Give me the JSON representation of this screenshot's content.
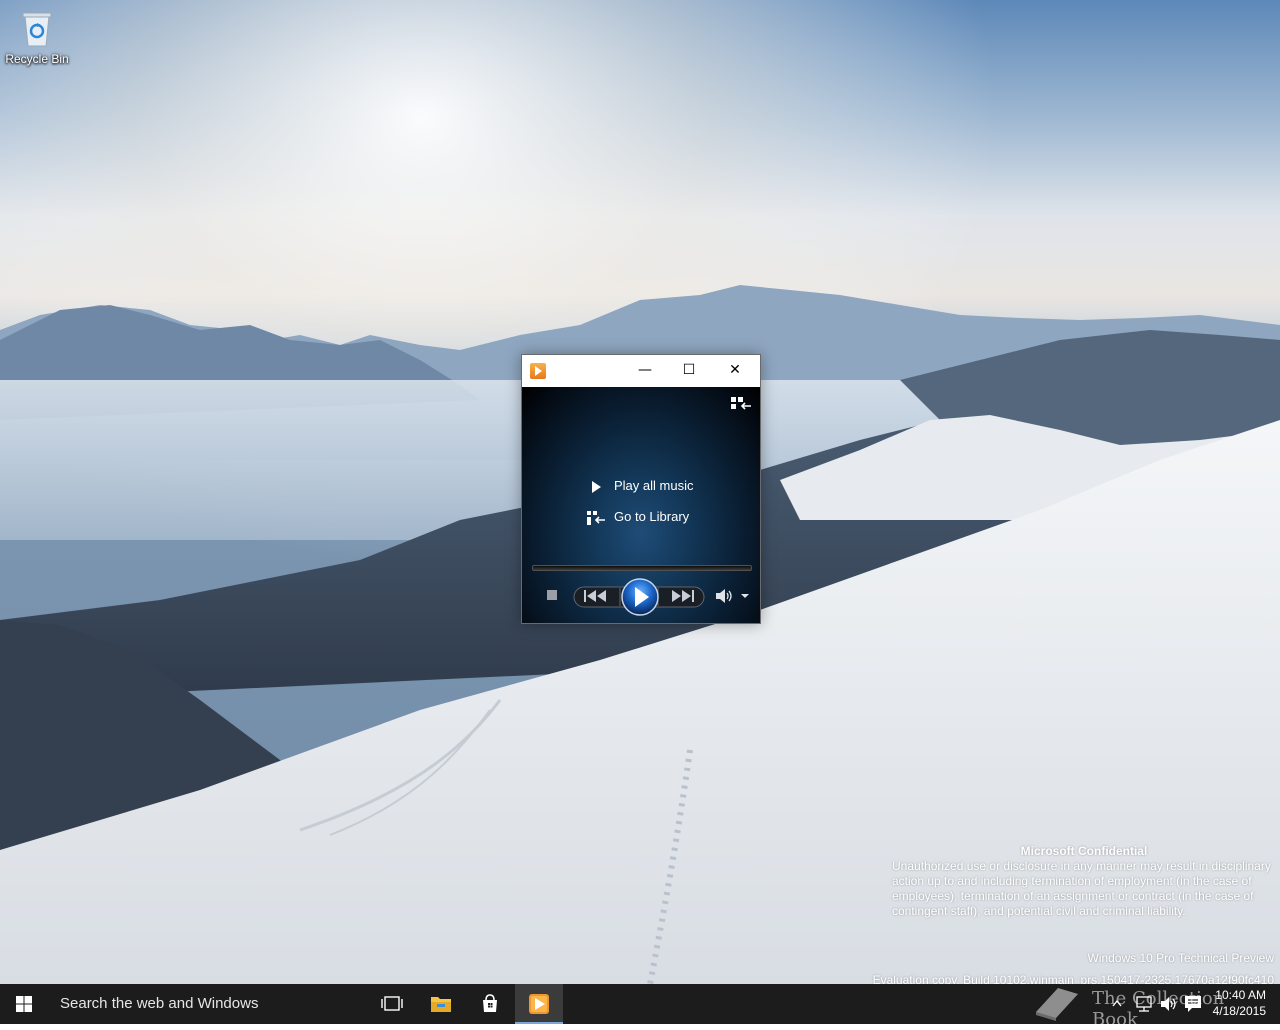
{
  "desktop": {
    "icons": [
      {
        "label": "Recycle Bin"
      }
    ],
    "watermark": {
      "title": "Microsoft Confidential",
      "body": "Unauthorized use or disclosure in any manner may result in disciplinary action up to and including termination of employment (in the case of employees), termination of an assignment or contract (in the case of contingent staff), and potential civil and criminal liability.",
      "edition": "Windows 10 Pro Technical Preview",
      "build": "Evaluation copy. Build 10102.winmain_prs.150417-2325.17670a12f90fc410"
    }
  },
  "player": {
    "title_buttons": {
      "minimize": "—",
      "maximize": "☐",
      "close": "✕"
    },
    "play_all_label": "Play all music",
    "go_library_label": "Go to Library"
  },
  "taskbar": {
    "search_placeholder": "Search the web and Windows",
    "clock_time": "10:40 AM",
    "clock_date": "4/18/2015",
    "brand_text": "The Collection Book"
  },
  "colors": {
    "taskbar_bg": "#1c1c1c",
    "accent": "#7aa7d6",
    "play_button": "#1a66c9"
  }
}
